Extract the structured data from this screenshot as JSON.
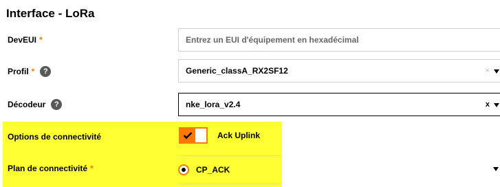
{
  "page": {
    "title": "Interface - LoRa"
  },
  "form": {
    "deveui": {
      "label": "DevEUI",
      "required_mark": "*",
      "placeholder": "Entrez un EUI d'équipement en hexadécimal"
    },
    "profil": {
      "label": "Profil",
      "required_mark": "*",
      "value": "Generic_classA_RX2SF12",
      "clear": "×",
      "help_icon": "help-icon"
    },
    "decodeur": {
      "label": "Décodeur",
      "value": "nke_lora_v2.4",
      "clear": "x",
      "help_icon": "help-icon"
    },
    "connectivite": {
      "label": "Options de connectivité",
      "option_label": "Ack Uplink",
      "checked": true
    },
    "plan": {
      "label": "Plan de connectivité",
      "required_mark": "*",
      "selected": "CP_ACK"
    }
  },
  "colors": {
    "accent": "#ff7900",
    "highlight": "#ffff33"
  }
}
